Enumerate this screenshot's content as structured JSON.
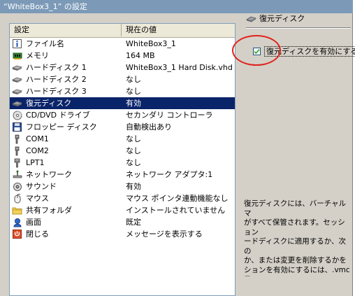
{
  "window": {
    "title": "“WhiteBox3_1” の設定"
  },
  "list": {
    "headers": {
      "setting": "設定",
      "value": "現在の値"
    },
    "rows": [
      {
        "icon": "info-icon",
        "label": "ファイル名",
        "value": "WhiteBox3_1"
      },
      {
        "icon": "memory-icon",
        "label": "メモリ",
        "value": "164 MB"
      },
      {
        "icon": "hard-disk-icon",
        "label": "ハードディスク 1",
        "value": "WhiteBox3_1 Hard Disk.vhd"
      },
      {
        "icon": "hard-disk-icon",
        "label": "ハードディスク 2",
        "value": "なし"
      },
      {
        "icon": "hard-disk-icon",
        "label": "ハードディスク 3",
        "value": "なし"
      },
      {
        "icon": "undo-disk-icon",
        "label": "復元ディスク",
        "value": "有効"
      },
      {
        "icon": "cd-dvd-icon",
        "label": "CD/DVD ドライブ",
        "value": "セカンダリ コントローラ"
      },
      {
        "icon": "floppy-icon",
        "label": "フロッピー ディスク",
        "value": "自動検出あり"
      },
      {
        "icon": "serial-port-icon",
        "label": "COM1",
        "value": "なし"
      },
      {
        "icon": "serial-port-icon",
        "label": "COM2",
        "value": "なし"
      },
      {
        "icon": "parallel-port-icon",
        "label": "LPT1",
        "value": "なし"
      },
      {
        "icon": "network-icon",
        "label": "ネットワーク",
        "value": "ネットワーク アダプタ:1"
      },
      {
        "icon": "sound-icon",
        "label": "サウンド",
        "value": "有効"
      },
      {
        "icon": "mouse-icon",
        "label": "マウス",
        "value": "マウス ポインタ連動機能なし"
      },
      {
        "icon": "folder-icon",
        "label": "共有フォルダ",
        "value": "インストールされていません"
      },
      {
        "icon": "display-icon",
        "label": "画面",
        "value": "既定"
      },
      {
        "icon": "close-icon",
        "label": "閉じる",
        "value": "メッセージを表示する"
      }
    ],
    "selected_index": 5
  },
  "panel": {
    "title": "復元ディスク",
    "checkbox_label": "復元ディスクを有効にする",
    "checkbox_checked": true,
    "description": "復元ディスクには、バーチャル マ\nがすべて保管されます。セッション\nードディスクに適用するか、次の\nか、または変更を削除するかを\nションを有効にするには、.vmc フ\n上に追加の空きディスク領域が"
  },
  "colors": {
    "selection": "#0a246a",
    "title_bar": "#7c9ab8",
    "annotation": "#e0231c"
  }
}
